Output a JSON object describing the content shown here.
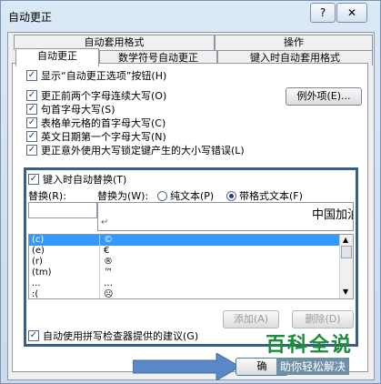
{
  "window": {
    "title": "自动更正",
    "help_icon": "?",
    "close_icon": "✕"
  },
  "tabs_top": [
    {
      "label": "自动套用格式"
    },
    {
      "label": "操作"
    }
  ],
  "tabs_bottom": [
    {
      "label": "自动更正"
    },
    {
      "label": "数学符号自动更正"
    },
    {
      "label": "键入时自动套用格式"
    }
  ],
  "options": {
    "show_buttons": "显示“自动更正选项”按钮(H)",
    "two_initials": "更正前两个字母连续大写(O)",
    "capitalize_sentence": "句首字母大写(S)",
    "capitalize_cells": "表格单元格的首字母大写(C)",
    "capitalize_days": "英文日期第一个字母大写(N)",
    "caps_lock": "更正意外使用大写锁定键产生的大小写错误(L)",
    "exceptions_button": "例外项(E)..."
  },
  "replace": {
    "enabled_label": "键入时自动替换(T)",
    "replace_label": "替换(R):",
    "with_label": "替换为(W):",
    "plain_text": "纯文本(P)",
    "formatted_text": "带格式文本(F)",
    "with_value": "中国加油",
    "newline_mark": "↵",
    "rows": [
      {
        "key": "(c)",
        "value": "©"
      },
      {
        "key": "(e)",
        "value": "€"
      },
      {
        "key": "(r)",
        "value": "®"
      },
      {
        "key": "(tm)",
        "value": "™"
      },
      {
        "key": "...",
        "value": "…"
      },
      {
        "key": ":(",
        "value": "☹"
      }
    ],
    "add_button": "添加(A)",
    "delete_button": "删除(D)",
    "spelling_label": "自动使用拼写检查器提供的建议(G)"
  },
  "ok_button_partial": "确",
  "watermark": {
    "main": "百科全说",
    "sub": "助你轻松解决"
  }
}
